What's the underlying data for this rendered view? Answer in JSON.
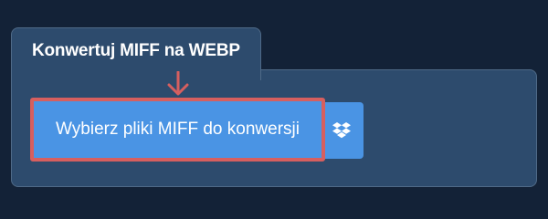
{
  "tab": {
    "title": "Konwertuj MIFF na WEBP"
  },
  "upload": {
    "select_label": "Wybierz pliki MIFF do konwersji",
    "dropbox_icon": "dropbox-icon",
    "arrow_icon": "arrow-down-icon"
  },
  "colors": {
    "background": "#132237",
    "panel": "#2d4b6d",
    "button": "#4a94e4",
    "highlight": "#d65f5f"
  }
}
